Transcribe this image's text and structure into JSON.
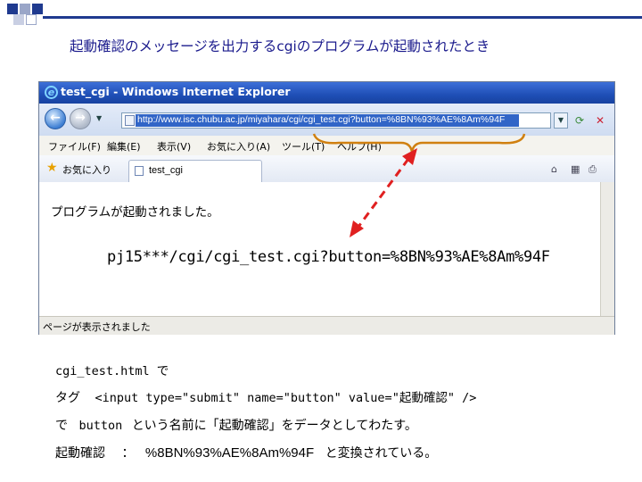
{
  "slide": {
    "title": "起動確認のメッセージを出力するcgiのプログラムが起動されたとき"
  },
  "browser": {
    "window_title": "test_cgi - Windows Internet Explorer",
    "url": "http://www.isc.chubu.ac.jp/miyahara/cgi/cgi_test.cgi?button=%8BN%93%AE%8Am%94F",
    "menu": [
      "ファイル(F)",
      "編集(E)",
      "表示(V)",
      "お気に入り(A)",
      "ツール(T)",
      "ヘルプ(H)"
    ],
    "favorites_label": "お気に入り",
    "tab_title": "test_cgi",
    "page_message": "プログラムが起動されました。",
    "status_text": "ページが表示されました"
  },
  "callout": {
    "url_fragment": "pj15***/cgi/cgi_test.cgi?button=%8BN%93%AE%8Am%94F"
  },
  "notes": {
    "line1": "cgi_test.html で",
    "line2_label": "タグ",
    "line2_code": "<input type=\"submit\" name=\"button\" value=\"起動確認\" />",
    "line3_prefix": "で",
    "line3_code": "button",
    "line3_suffix": "という名前に「起動確認」をデータとしてわたす。",
    "line4_word": "起動確認",
    "line4_colon": "：",
    "line4_encoded": "%8BN%93%AE%8Am%94F",
    "line4_suffix": "と変換されている。"
  },
  "colors": {
    "title_text": "#1a1a8c",
    "arrow": "#e02020",
    "brace": "#d08010"
  }
}
